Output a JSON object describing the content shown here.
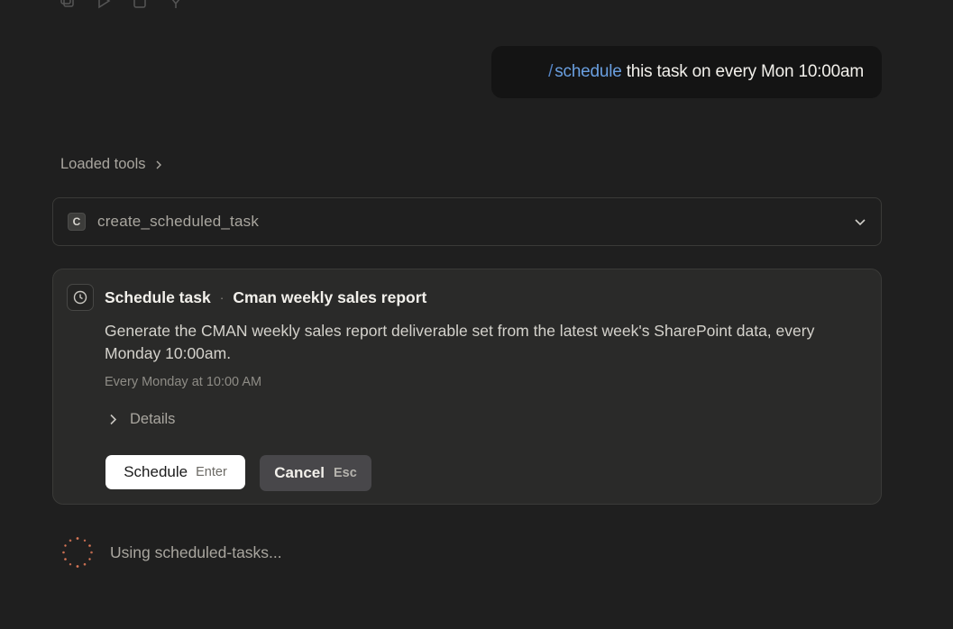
{
  "top_toolbar": {
    "icons": [
      "copy-icon",
      "play-icon",
      "file-icon",
      "pin-icon"
    ]
  },
  "user_message": {
    "slash": "/",
    "command": "schedule",
    "text": "this task on every Mon 10:00am"
  },
  "loaded_tools": {
    "label": "Loaded tools"
  },
  "tool_call": {
    "badge": "C",
    "name": "create_scheduled_task"
  },
  "schedule_card": {
    "title": "Schedule task",
    "separator": "·",
    "task_name": "Cman weekly sales report",
    "description": "Generate the CMAN weekly sales report deliverable set from the latest week's SharePoint data, every Monday 10:00am.",
    "recurrence": "Every Monday at 10:00 AM",
    "details_label": "Details",
    "schedule_button": {
      "label": "Schedule",
      "shortcut": "Enter"
    },
    "cancel_button": {
      "label": "Cancel",
      "shortcut": "Esc"
    }
  },
  "status": {
    "text": "Using scheduled-tasks..."
  },
  "colors": {
    "background": "#1f1f1f",
    "command_accent": "#6a9fe0",
    "spinner": "#d97757"
  }
}
